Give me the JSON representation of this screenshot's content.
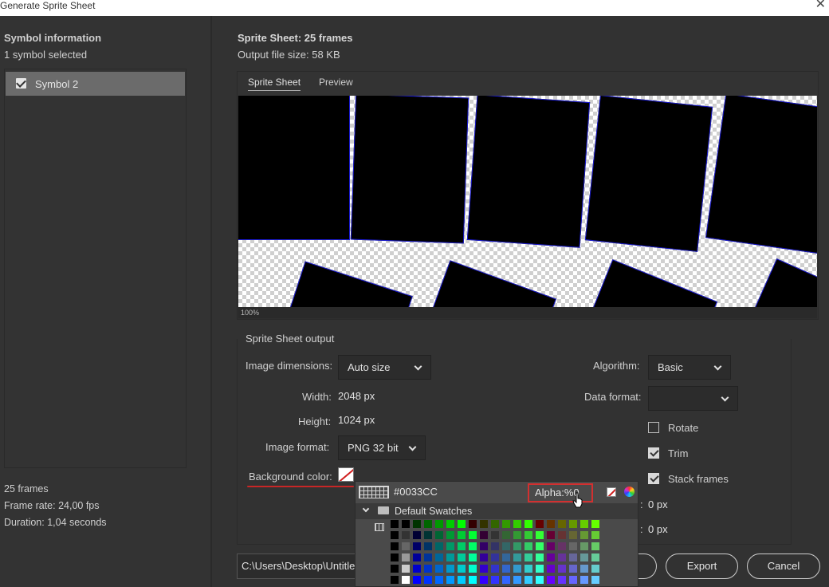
{
  "window": {
    "title": "Generate Sprite Sheet",
    "close": "✕"
  },
  "symbols": {
    "heading": "Symbol information",
    "selected_text": "1 symbol selected",
    "items": [
      {
        "label": "Symbol 2",
        "checked": true
      }
    ]
  },
  "stats": {
    "frames": "25 frames",
    "frame_rate": "Frame rate: 24,00 fps",
    "duration": "Duration: 1,04 seconds"
  },
  "sheet_info": {
    "title": "Sprite Sheet: 25 frames",
    "file_size": "Output file size: 58 KB"
  },
  "preview": {
    "tabs": [
      {
        "label": "Sprite Sheet",
        "active": true
      },
      {
        "label": "Preview",
        "active": false
      }
    ],
    "zoom": "100%",
    "frame_fill": "#000000",
    "frame_border": "#1b1bd0"
  },
  "output": {
    "title": "Sprite Sheet output",
    "image_dimensions_label": "Image dimensions:",
    "image_dimensions_value": "Auto size",
    "width_label": "Width:",
    "width_value": "2048",
    "height_label": "Height:",
    "height_value": "1024",
    "unit_px": "px",
    "image_format_label": "Image format:",
    "image_format_value": "PNG 32 bit",
    "background_label": "Background color:",
    "algorithm_label": "Algorithm:",
    "algorithm_value": "Basic",
    "data_format_label": "Data format:",
    "data_format_value": "",
    "rotate": {
      "label": "Rotate",
      "checked": false
    },
    "trim": {
      "label": "Trim",
      "checked": true
    },
    "stack_frames": {
      "label": "Stack frames",
      "checked": true
    },
    "padding_1": "0 px",
    "padding_2": "0 px",
    "separator_1": ":",
    "separator_2": ":"
  },
  "color_picker": {
    "hex": "#0033CC",
    "alpha_label": "Alpha:%",
    "alpha_value": "0",
    "group_name": "Default Swatches",
    "swatch_colors": [
      [
        "#000000",
        "#000000",
        "#003300",
        "#006600",
        "#009900",
        "#00cc00",
        "#00ff00",
        "#330000",
        "#333300",
        "#336600",
        "#339900",
        "#33cc00",
        "#33ff00",
        "#660000",
        "#663300",
        "#666600",
        "#669900",
        "#66cc00",
        "#66ff00"
      ],
      [
        "#000000",
        "#333333",
        "#000033",
        "#003333",
        "#006633",
        "#009933",
        "#00cc33",
        "#00ff33",
        "#330033",
        "#333333",
        "#336633",
        "#339933",
        "#33cc33",
        "#33ff33",
        "#660033",
        "#663333",
        "#666633",
        "#669933",
        "#66cc33"
      ],
      [
        "#000000",
        "#666666",
        "#000066",
        "#003366",
        "#006666",
        "#009966",
        "#00cc66",
        "#00ff66",
        "#330066",
        "#333366",
        "#336666",
        "#339966",
        "#33cc66",
        "#33ff66",
        "#660066",
        "#663366",
        "#666666",
        "#669966",
        "#66cc66"
      ],
      [
        "#000000",
        "#999999",
        "#000099",
        "#003399",
        "#006699",
        "#009999",
        "#00cc99",
        "#00ff99",
        "#330099",
        "#333399",
        "#336699",
        "#339999",
        "#33cc99",
        "#33ff99",
        "#660099",
        "#663399",
        "#666699",
        "#669999",
        "#66cc99"
      ],
      [
        "#000000",
        "#cccccc",
        "#0000cc",
        "#0033cc",
        "#0066cc",
        "#0099cc",
        "#00cccc",
        "#00ffcc",
        "#3300cc",
        "#3333cc",
        "#3366cc",
        "#3399cc",
        "#33cccc",
        "#33ffcc",
        "#6600cc",
        "#6633cc",
        "#6666cc",
        "#6699cc",
        "#66cccc"
      ],
      [
        "#000000",
        "#ffffff",
        "#0000ff",
        "#0033ff",
        "#0066ff",
        "#0099ff",
        "#00ccff",
        "#00ffff",
        "#3300ff",
        "#3333ff",
        "#3366ff",
        "#3399ff",
        "#33ccff",
        "#33ffff",
        "#6600ff",
        "#6633ff",
        "#6666ff",
        "#6699ff",
        "#66ccff"
      ],
      [
        "#000000",
        "#ff0000",
        "#990000",
        "#993300",
        "#996600",
        "#999900",
        "#99cc00",
        "#99ff00",
        "#cc0000",
        "#cc3300",
        "#cc6600",
        "#cc9900",
        "#cccc00",
        "#ccff00",
        "#ff0000",
        "#ff3300",
        "#ff6600",
        "#ff9900",
        "#ffcc00"
      ]
    ]
  },
  "footer": {
    "path": "C:\\Users\\Desktop\\Untitled",
    "export_label": "Export",
    "cancel_label": "Cancel"
  },
  "colors": {
    "annotation_red": "#c82626",
    "panel": "#323232"
  }
}
